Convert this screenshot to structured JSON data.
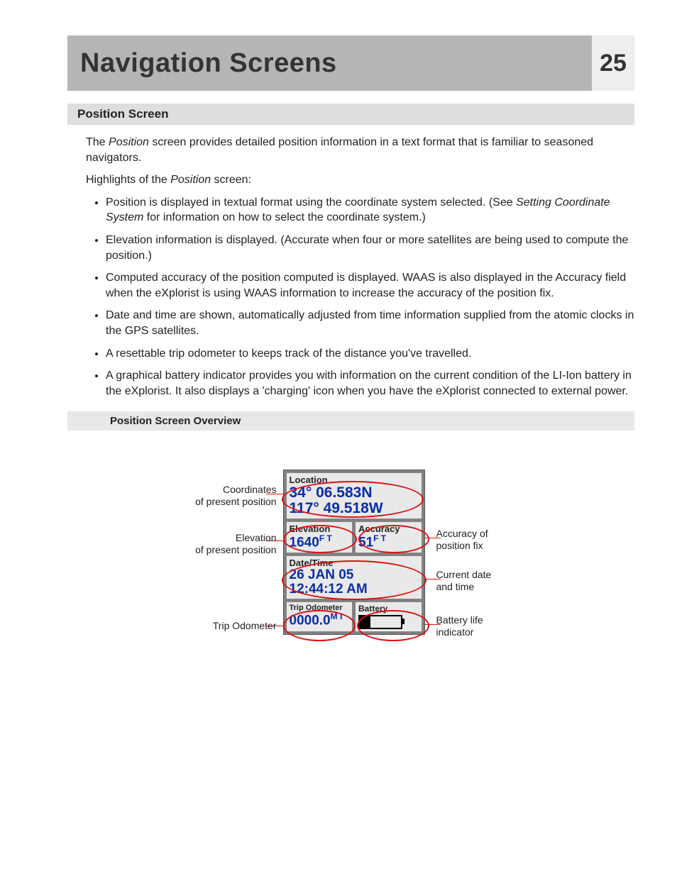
{
  "header": {
    "title": "Navigation Screens",
    "page_number": "25"
  },
  "section": {
    "heading": "Position Screen",
    "intro_1a": "The ",
    "intro_1b_italic": "Position",
    "intro_1c": " screen provides detailed position information in a text format that is familiar to seasoned navigators.",
    "intro_2a": "Highlights of the ",
    "intro_2b_italic": "Position",
    "intro_2c": " screen:"
  },
  "bullets": [
    {
      "pre": "Position is displayed in textual format using the coordinate system selected.  (See ",
      "italic": "Setting Coordinate System",
      "post": " for information on how to select the coordinate system.)"
    },
    {
      "pre": "Elevation information is displayed.  (Accurate when four or more satellites are being used to compute the position.)",
      "italic": "",
      "post": ""
    },
    {
      "pre": "Computed accuracy of the position computed is displayed.  WAAS is also displayed in the Accuracy field when the eXplorist is using WAAS information to increase the accuracy of the position fix.",
      "italic": "",
      "post": ""
    },
    {
      "pre": "Date and time are shown, automatically adjusted from time information supplied from the atomic clocks in the GPS satellites.",
      "italic": "",
      "post": ""
    },
    {
      "pre": "A resettable trip odometer to keeps track of the distance you've travelled.",
      "italic": "",
      "post": ""
    },
    {
      "pre": "A graphical battery indicator provides you with information on the current condition of the LI-Ion battery in the eXplorist.  It also displays a 'charging' icon when you have the eXplorist connected to external power.",
      "italic": "",
      "post": ""
    }
  ],
  "sub_heading": "Position Screen Overview",
  "device": {
    "location_label": "Location",
    "lat": "34° 06.583N",
    "lon": "117° 49.518W",
    "elevation_label": "Elevation",
    "elevation_value": "1640",
    "elevation_unit": "F T",
    "accuracy_label": "Accuracy",
    "accuracy_value": "51",
    "accuracy_unit": "F T",
    "datetime_label": "Date/Time",
    "date_value": "26 JAN 05",
    "time_value": "12:44:12 AM",
    "odometer_label": "Trip Odometer",
    "odometer_value": "0000.0",
    "odometer_unit": "M I",
    "battery_label": "Battery"
  },
  "callouts": {
    "coords": "Coordinates\nof present position",
    "elev": "Elevation\nof present position",
    "odo": "Trip Odometer",
    "acc": "Accuracy of\nposition fix",
    "dt": "Current date\nand time",
    "batt": "Battery life\nindicator"
  }
}
